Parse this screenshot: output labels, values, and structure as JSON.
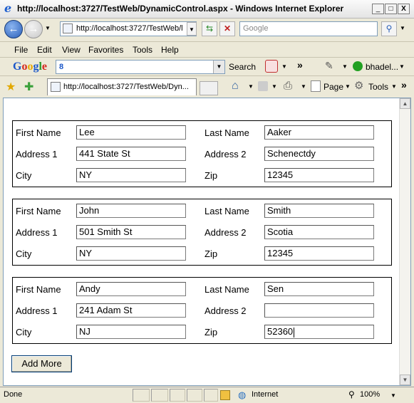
{
  "window": {
    "title": "http://localhost:3727/TestWeb/DynamicControl.aspx - Windows Internet Explorer",
    "min": "_",
    "max": "□",
    "close": "X"
  },
  "nav": {
    "back_icon": "←",
    "forward_icon": "→",
    "address": "http://localhost:3727/TestWeb/l",
    "search_placeholder": "Google"
  },
  "menu": [
    "File",
    "Edit",
    "View",
    "Favorites",
    "Tools",
    "Help"
  ],
  "google_toolbar": {
    "logo": "Google",
    "combo_value": "8",
    "search_label": "Search",
    "chevron": "»",
    "user": "bhadel..."
  },
  "tab": {
    "title": "http://localhost:3727/TestWeb/Dyn...",
    "page_label": "Page",
    "tools_label": "Tools"
  },
  "form": {
    "labels": {
      "first_name": "First Name",
      "last_name": "Last Name",
      "address1": "Address 1",
      "address2": "Address 2",
      "city": "City",
      "zip": "Zip"
    },
    "entries": [
      {
        "first_name": "Lee",
        "last_name": "Aaker",
        "address1": "441 State St",
        "address2": "Schenectdy",
        "city": "NY",
        "zip": "12345"
      },
      {
        "first_name": "John",
        "last_name": "Smith",
        "address1": "501 Smith St",
        "address2": "Scotia",
        "city": "NY",
        "zip": "12345"
      },
      {
        "first_name": "Andy",
        "last_name": "Sen",
        "address1": "241 Adam St",
        "address2": "",
        "city": "NJ",
        "zip": "52360"
      }
    ],
    "add_more": "Add More"
  },
  "status": {
    "text": "Done",
    "zone": "Internet",
    "zoom": "100%"
  }
}
